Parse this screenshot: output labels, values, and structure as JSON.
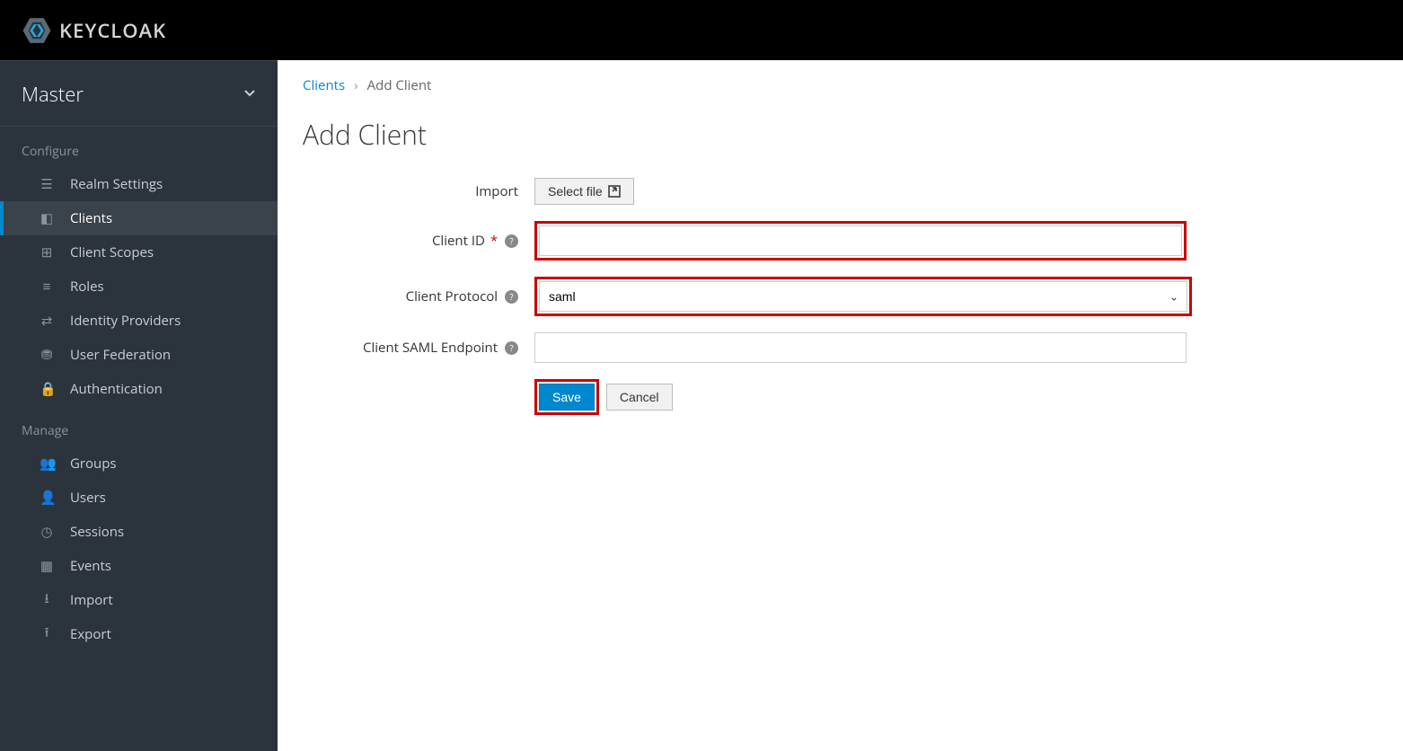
{
  "app": {
    "name": "KEYCLOAK"
  },
  "realm": {
    "name": "Master"
  },
  "sidebar": {
    "configure_label": "Configure",
    "manage_label": "Manage",
    "configure": [
      {
        "label": "Realm Settings",
        "icon": "sliders"
      },
      {
        "label": "Clients",
        "icon": "cube",
        "active": true
      },
      {
        "label": "Client Scopes",
        "icon": "scopes"
      },
      {
        "label": "Roles",
        "icon": "list"
      },
      {
        "label": "Identity Providers",
        "icon": "exchange"
      },
      {
        "label": "User Federation",
        "icon": "database"
      },
      {
        "label": "Authentication",
        "icon": "lock"
      }
    ],
    "manage": [
      {
        "label": "Groups",
        "icon": "users"
      },
      {
        "label": "Users",
        "icon": "user"
      },
      {
        "label": "Sessions",
        "icon": "clock"
      },
      {
        "label": "Events",
        "icon": "calendar"
      },
      {
        "label": "Import",
        "icon": "import"
      },
      {
        "label": "Export",
        "icon": "export"
      }
    ]
  },
  "breadcrumb": {
    "parent": "Clients",
    "current": "Add Client"
  },
  "page": {
    "title": "Add Client"
  },
  "form": {
    "import_label": "Import",
    "select_file_label": "Select file",
    "client_id_label": "Client ID",
    "client_id_value": "",
    "client_protocol_label": "Client Protocol",
    "client_protocol_value": "saml",
    "client_saml_endpoint_label": "Client SAML Endpoint",
    "client_saml_endpoint_value": "",
    "save_label": "Save",
    "cancel_label": "Cancel"
  }
}
